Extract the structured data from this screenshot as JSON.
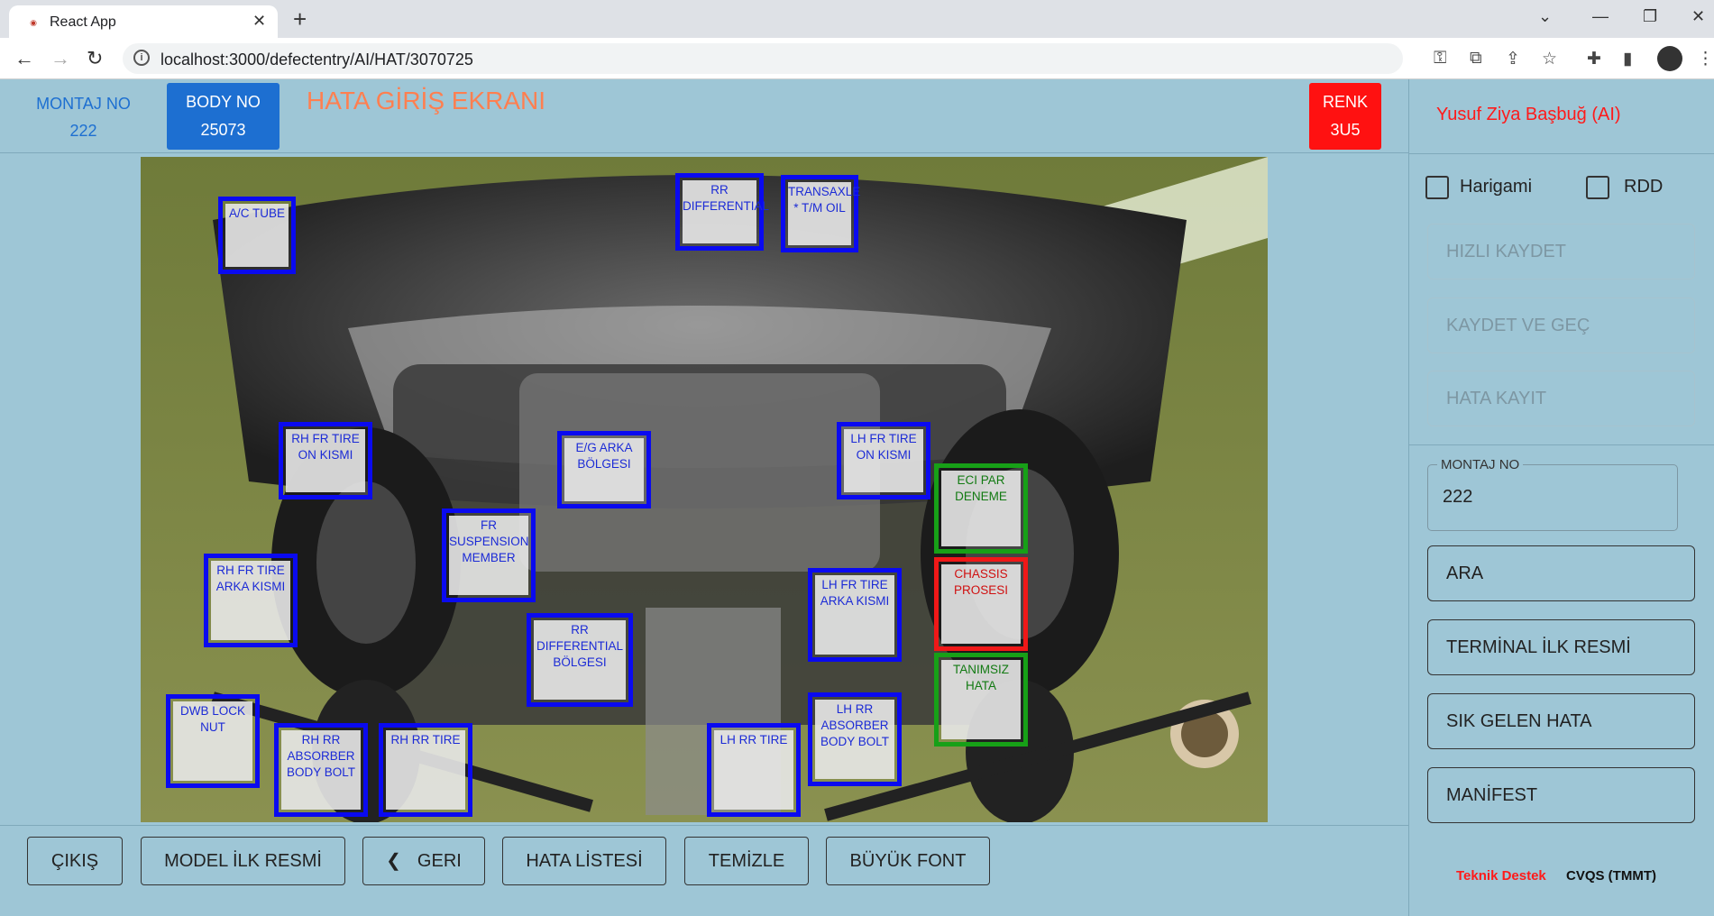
{
  "browser": {
    "tab_title": "React App",
    "favicon_text": "TOYOTA",
    "url": "localhost:3000/defectentry/AI/HAT/3070725"
  },
  "header": {
    "montaj_label": "MONTAJ NO",
    "montaj_value": "222",
    "body_label": "BODY NO",
    "body_value": "25073",
    "title": "HATA GİRİŞ EKRANI",
    "renk_label": "RENK",
    "renk_value": "3U5"
  },
  "zones": [
    {
      "label": "A/C TUBE",
      "status": "blue"
    },
    {
      "label": "RR DIFFERENTIAL",
      "status": "blue"
    },
    {
      "label": "TRANSAXLE * T/M OIL",
      "status": "blue"
    },
    {
      "label": "RH FR TIRE ON KISMI",
      "status": "blue"
    },
    {
      "label": "E/G ARKA BÖLGESI",
      "status": "blue"
    },
    {
      "label": "LH FR TIRE ON KISMI",
      "status": "blue"
    },
    {
      "label": "ECI PAR DENEME",
      "status": "green"
    },
    {
      "label": "FR SUSPENSION MEMBER",
      "status": "blue"
    },
    {
      "label": "RH FR TIRE ARKA KISMI",
      "status": "blue"
    },
    {
      "label": "LH FR TIRE ARKA KISMI",
      "status": "blue"
    },
    {
      "label": "CHASSIS PROSESI",
      "status": "red"
    },
    {
      "label": "RR DIFFERENTIAL BÖLGESI",
      "status": "blue"
    },
    {
      "label": "TANIMSIZ HATA",
      "status": "green"
    },
    {
      "label": "DWB LOCK NUT",
      "status": "blue"
    },
    {
      "label": "RH RR ABSORBER BODY BOLT",
      "status": "blue"
    },
    {
      "label": "RH RR TIRE",
      "status": "blue"
    },
    {
      "label": "LH RR TIRE",
      "status": "blue"
    },
    {
      "label": "LH RR ABSORBER BODY BOLT",
      "status": "blue"
    }
  ],
  "footer": {
    "exit": "ÇIKIŞ",
    "model_first": "MODEL İLK RESMİ",
    "back": "GERI",
    "defect_list": "HATA LİSTESİ",
    "clear": "TEMİZLE",
    "big_font": "BÜYÜK FONT"
  },
  "panel": {
    "user": "Yusuf Ziya Başbuğ (AI)",
    "checkbox_harigami": "Harigami",
    "checkbox_rdd": "RDD",
    "quick_save": "HIZLI KAYDET",
    "save_next": "KAYDET VE GEÇ",
    "defect_record": "HATA KAYIT",
    "montaj_legend": "MONTAJ NO",
    "montaj_value": "222",
    "search": "ARA",
    "terminal_first": "TERMİNAL İLK RESMİ",
    "frequent": "SIK GELEN HATA",
    "manifest": "MANİFEST",
    "support": "Teknik Destek",
    "brand": "CVQS (TMMT)"
  },
  "colors": {
    "background": "#9ec6d6",
    "accent_blue": "#1d6fd1",
    "title_orange": "#ff7f50",
    "renk_red": "#ff1111",
    "zone_blue": "#0a0af0",
    "zone_green": "#17a017",
    "zone_red": "#f01818"
  }
}
